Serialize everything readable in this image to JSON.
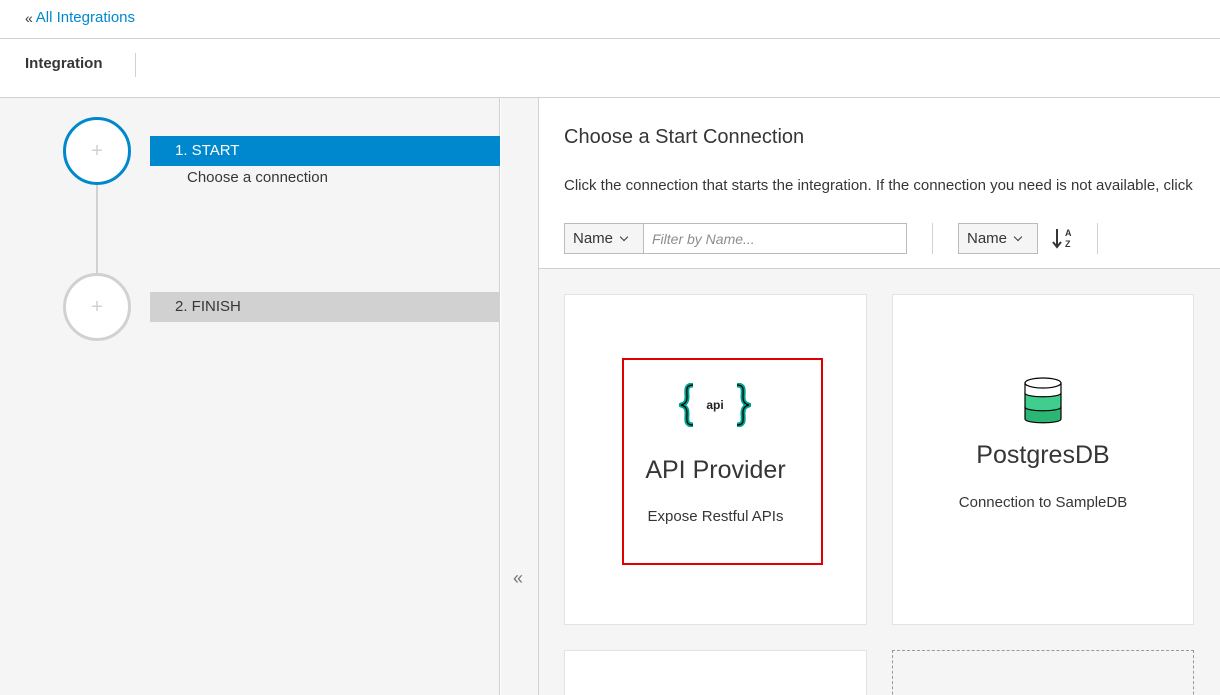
{
  "breadcrumb": {
    "chevron": "«",
    "link_label": "All Integrations"
  },
  "header": {
    "title": "Integration"
  },
  "steps": [
    {
      "plus": "+",
      "label": "1. START",
      "sub": "Choose a connection"
    },
    {
      "plus": "+",
      "label": "2. FINISH"
    }
  ],
  "collapse": {
    "glyph": "«"
  },
  "main": {
    "title": "Choose a Start Connection",
    "description": "Click the connection that starts the integration. If the connection you need is not available, click"
  },
  "filter": {
    "type_label": "Name",
    "placeholder": "Filter by Name...",
    "sort_label": "Name",
    "sort_icon": "sort-alpha-asc-icon"
  },
  "cards": [
    {
      "name": "API Provider",
      "description": "Expose Restful APIs",
      "icon": "api-icon",
      "icon_text": "api"
    },
    {
      "name": "PostgresDB",
      "description": "Connection to SampleDB",
      "icon": "database-icon"
    }
  ],
  "colors": {
    "accent": "#0088ce",
    "highlight": "#e00000",
    "api_teal": "#00a18c",
    "db_green": "#3fce8e"
  }
}
